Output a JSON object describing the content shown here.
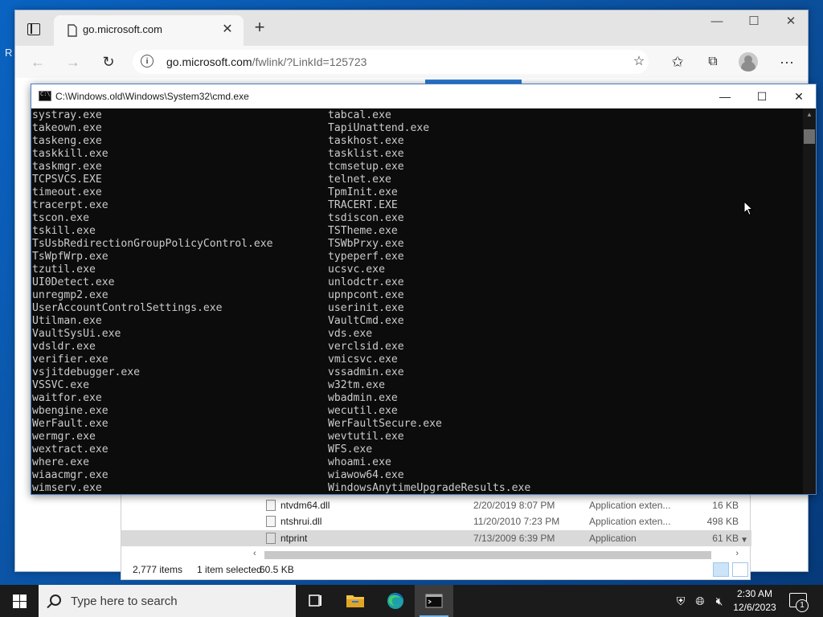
{
  "desktop": {
    "glyph": "R"
  },
  "browser": {
    "tab_title": "go.microsoft.com",
    "address_host": "go.microsoft.com",
    "address_path": "/fwlink/?LinkId=125723",
    "colors": {
      "accent": "#2b78d4"
    }
  },
  "explorer": {
    "files": [
      {
        "name": "ntvdm64.dll",
        "date": "2/20/2019 8:07 PM",
        "type": "Application exten...",
        "size": "16 KB",
        "selected": false
      },
      {
        "name": "ntshrui.dll",
        "date": "11/20/2010 7:23 PM",
        "type": "Application exten...",
        "size": "498 KB",
        "selected": false
      },
      {
        "name": "ntprint",
        "date": "7/13/2009 6:39 PM",
        "type": "Application",
        "size": "61 KB",
        "selected": true
      }
    ],
    "status_count": "2,777 items",
    "status_selected": "1 item selected",
    "status_size": "60.5 KB"
  },
  "cmd": {
    "title": "C:\\Windows.old\\Windows\\System32\\cmd.exe",
    "left_column": [
      "systray.exe",
      "takeown.exe",
      "taskeng.exe",
      "taskkill.exe",
      "taskmgr.exe",
      "TCPSVCS.EXE",
      "timeout.exe",
      "tracerpt.exe",
      "tscon.exe",
      "tskill.exe",
      "TsUsbRedirectionGroupPolicyControl.exe",
      "TsWpfWrp.exe",
      "tzutil.exe",
      "UI0Detect.exe",
      "unregmp2.exe",
      "UserAccountControlSettings.exe",
      "Utilman.exe",
      "VaultSysUi.exe",
      "vdsldr.exe",
      "verifier.exe",
      "vsjitdebugger.exe",
      "VSSVC.exe",
      "waitfor.exe",
      "wbengine.exe",
      "WerFault.exe",
      "wermgr.exe",
      "wextract.exe",
      "where.exe",
      "wiaacmgr.exe",
      "wimserv.exe"
    ],
    "right_column": [
      "tabcal.exe",
      "TapiUnattend.exe",
      "taskhost.exe",
      "tasklist.exe",
      "tcmsetup.exe",
      "telnet.exe",
      "TpmInit.exe",
      "TRACERT.EXE",
      "tsdiscon.exe",
      "TSTheme.exe",
      "TSWbPrxy.exe",
      "typeperf.exe",
      "ucsvc.exe",
      "unlodctr.exe",
      "upnpcont.exe",
      "userinit.exe",
      "VaultCmd.exe",
      "vds.exe",
      "verclsid.exe",
      "vmicsvc.exe",
      "vssadmin.exe",
      "w32tm.exe",
      "wbadmin.exe",
      "wecutil.exe",
      "WerFaultSecure.exe",
      "wevtutil.exe",
      "WFS.exe",
      "whoami.exe",
      "wiawow64.exe",
      "WindowsAnytimeUpgradeResults.exe"
    ],
    "colors": {
      "background": "#0c0c0c",
      "text": "#cccccc"
    }
  },
  "taskbar": {
    "search_placeholder": "Type here to search",
    "time": "2:30 AM",
    "date": "12/6/2023",
    "notification_count": "1",
    "apps": [
      "task-view-icon",
      "file-explorer-icon",
      "edge-icon",
      "cmd-icon"
    ]
  }
}
